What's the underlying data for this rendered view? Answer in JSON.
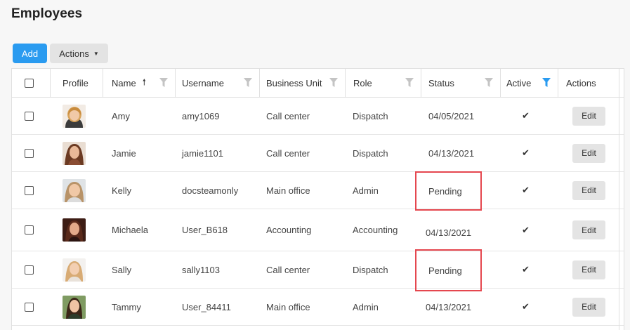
{
  "page": {
    "title": "Employees"
  },
  "toolbar": {
    "add_label": "Add",
    "actions_label": "Actions"
  },
  "columns": {
    "profile": "Profile",
    "name": "Name",
    "username": "Username",
    "business_unit": "Business Unit",
    "role": "Role",
    "status": "Status",
    "active": "Active",
    "actions": "Actions"
  },
  "sort": {
    "column": "name",
    "direction": "ascending"
  },
  "colors": {
    "accent": "#2a9bf0",
    "highlight": "#e5474f",
    "filter_active": "#2a9bf0"
  },
  "rows": [
    {
      "name": "Amy",
      "username": "amy1069",
      "business_unit": "Call center",
      "role": "Dispatch",
      "status": "04/05/2021",
      "active": "✔",
      "edit": "Edit"
    },
    {
      "name": "Jamie",
      "username": "jamie1101",
      "business_unit": "Call center",
      "role": "Dispatch",
      "status": "04/13/2021",
      "active": "✔",
      "edit": "Edit"
    },
    {
      "name": "Kelly",
      "username": "docsteamonly",
      "business_unit": "Main office",
      "role": "Admin",
      "status": "Pending",
      "active": "✔",
      "edit": "Edit"
    },
    {
      "name": "Michaela",
      "username": "User_B618",
      "business_unit": "Accounting",
      "role": "Accounting",
      "status": "04/13/2021",
      "active": "✔",
      "edit": "Edit"
    },
    {
      "name": "Sally",
      "username": "sally1103",
      "business_unit": "Call center",
      "role": "Dispatch",
      "status": "Pending",
      "active": "✔",
      "edit": "Edit"
    },
    {
      "name": "Tammy",
      "username": "User_84411",
      "business_unit": "Main office",
      "role": "Admin",
      "status": "04/13/2021",
      "active": "✔",
      "edit": "Edit"
    }
  ]
}
